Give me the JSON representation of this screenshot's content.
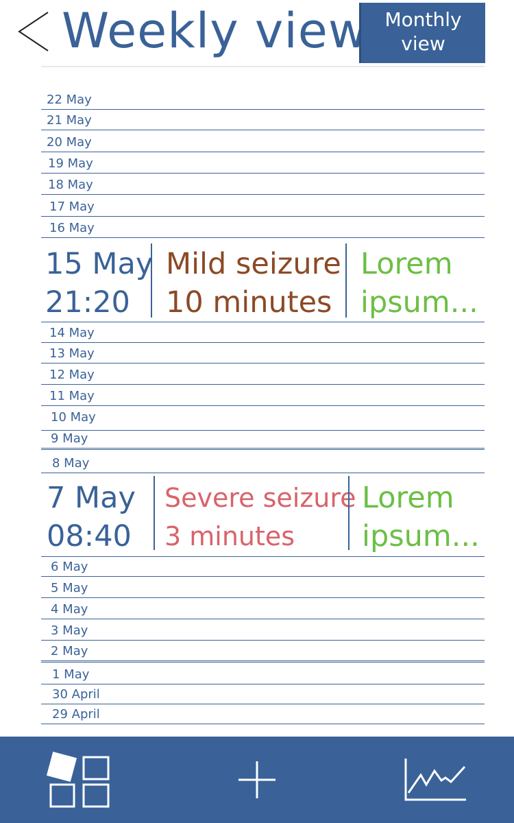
{
  "header": {
    "title": "Weekly view",
    "monthly_button": {
      "line1": "Monthly",
      "line2": "view"
    }
  },
  "days_top": [
    "22 May",
    "21 May",
    "20 May",
    "19 May",
    "18 May",
    "17 May",
    "16 May"
  ],
  "event1": {
    "date": "15 May",
    "time": "21:20",
    "severity": "Mild seizure",
    "duration": "10 minutes",
    "note_line1": "Lorem",
    "note_line2": "ipsum...",
    "color": "#8b4a26"
  },
  "days_mid": [
    "14 May",
    "13 May",
    "12 May",
    "11 May",
    "10 May",
    "9 May",
    "8 May"
  ],
  "event2": {
    "date": "7 May",
    "time": "08:40",
    "severity": "Severe seizure",
    "duration": "3 minutes",
    "note_line1": "Lorem",
    "note_line2": "ipsum...",
    "color": "#d9636a"
  },
  "days_bottom": [
    "6 May",
    "5 May",
    "4 May",
    "3 May",
    "2 May",
    "1 May",
    "30 April",
    "29 April"
  ],
  "colors": {
    "primary": "#3a6298",
    "note": "#6cbf45"
  },
  "nav": {
    "icons": [
      "dashboard-icon",
      "plus-icon",
      "chart-icon"
    ]
  }
}
